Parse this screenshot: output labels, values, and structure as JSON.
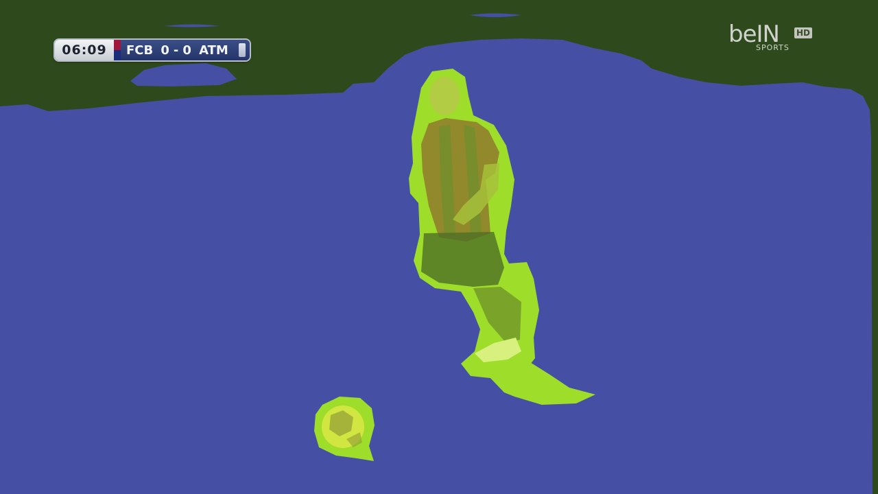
{
  "scoreboard": {
    "clock": "06:09",
    "home_team": "FCB",
    "home_score": "0",
    "separator": "-",
    "away_score": "0",
    "away_team": "ATM"
  },
  "broadcaster": {
    "brand": "beIN",
    "badge": "HD",
    "sub": "SPORTS"
  },
  "segmentation": {
    "colors": {
      "background": "#2e4a1d",
      "pitch": "#4550a5",
      "person_ball": "#9ede2a"
    },
    "classes": [
      "background",
      "pitch",
      "player",
      "ball"
    ]
  }
}
